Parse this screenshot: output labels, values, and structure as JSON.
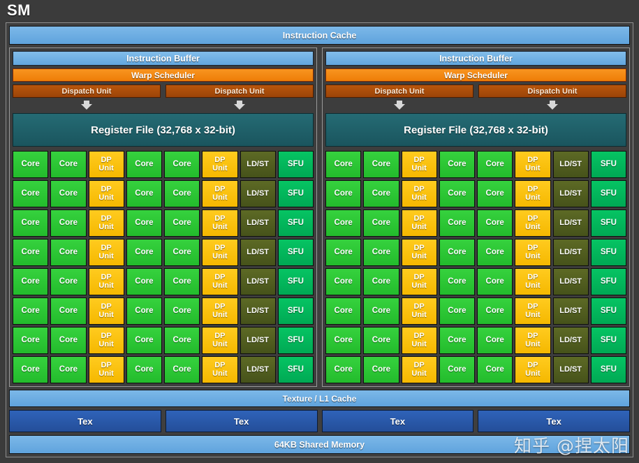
{
  "title": "SM",
  "instruction_cache": "Instruction Cache",
  "processing_block": {
    "instruction_buffer": "Instruction Buffer",
    "warp_scheduler": "Warp Scheduler",
    "dispatch_unit_left": "Dispatch Unit",
    "dispatch_unit_right": "Dispatch Unit",
    "register_file": "Register File (32,768 x 32-bit)",
    "row_count": 8,
    "column_labels": [
      "Core",
      "Core",
      "DP Unit",
      "Core",
      "Core",
      "DP Unit",
      "LD/ST",
      "SFU"
    ],
    "unit_types": [
      "core",
      "core",
      "dp",
      "core",
      "core",
      "dp",
      "ldst",
      "sfu"
    ],
    "dp_line1": "DP",
    "dp_line2": "Unit"
  },
  "memory": {
    "texture_l1_cache": "Texture / L1 Cache",
    "tex_blocks": [
      "Tex",
      "Tex",
      "Tex",
      "Tex"
    ],
    "shared_memory": "64KB Shared Memory"
  },
  "watermark": "知乎 @捏太阳",
  "colors": {
    "background": "#3b3b3b",
    "cache_blue": "#5fa3dd",
    "warp_orange": "#ee7d07",
    "dispatch_brown": "#9c4408",
    "register_teal": "#1a555e",
    "core_green": "#23bb2c",
    "dp_yellow": "#f5b800",
    "ldst_olive": "#46521a",
    "sfu_green": "#00a954",
    "tex_blue": "#244e99"
  }
}
